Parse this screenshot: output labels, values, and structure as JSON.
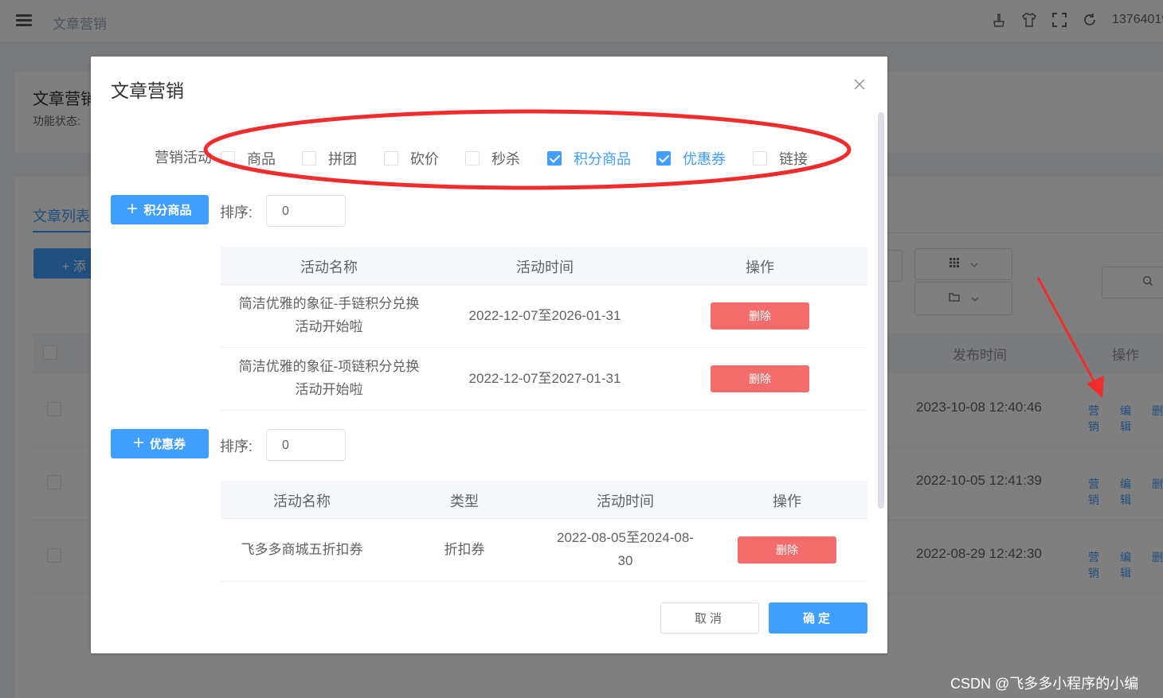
{
  "app": {
    "breadcrumb": "文章营销",
    "user": "13764019"
  },
  "page": {
    "card_title": "文章营销",
    "card_sub": "功能状态:",
    "tab_label": "文章列表",
    "add_button": "+ 添",
    "table_headers": {
      "publish_time": "发布时间",
      "ops": "操作"
    },
    "rows": [
      {
        "time": "2023-10-08 12:40:46",
        "op_marketing": "营销",
        "op_edit": "编辑",
        "op_more": "删"
      },
      {
        "time": "2022-10-05 12:41:39",
        "op_marketing": "营销",
        "op_edit": "编辑",
        "op_more": "删"
      },
      {
        "time": "2022-08-29 12:42:30",
        "op_marketing": "营销",
        "op_edit": "编辑",
        "op_more": "删"
      }
    ]
  },
  "dialog": {
    "title": "文章营销",
    "activity_label": "营销活动",
    "checkboxes": [
      {
        "label": "商品",
        "checked": false
      },
      {
        "label": "拼团",
        "checked": false
      },
      {
        "label": "砍价",
        "checked": false
      },
      {
        "label": "秒杀",
        "checked": false
      },
      {
        "label": "积分商品",
        "checked": true
      },
      {
        "label": "优惠券",
        "checked": true
      },
      {
        "label": "链接",
        "checked": false
      }
    ],
    "points_section": {
      "button_label": "积分商品",
      "sort_label": "排序:",
      "sort_value": "0",
      "headers": [
        "活动名称",
        "活动时间",
        "操作"
      ],
      "rows": [
        {
          "name_line1": "简洁优雅的象征-手链积分兑换",
          "name_line2": "活动开始啦",
          "time": "2022-12-07至2026-01-31",
          "action": "删除"
        },
        {
          "name_line1": "简洁优雅的象征-项链积分兑换",
          "name_line2": "活动开始啦",
          "time": "2022-12-07至2027-01-31",
          "action": "删除"
        }
      ]
    },
    "coupon_section": {
      "button_label": "优惠券",
      "sort_label": "排序:",
      "sort_value": "0",
      "headers": [
        "活动名称",
        "类型",
        "活动时间",
        "操作"
      ],
      "rows": [
        {
          "name": "飞多多商城五折扣券",
          "type": "折扣券",
          "time_line1": "2022-08-05至2024-08-",
          "time_line2": "30",
          "action": "删除"
        }
      ]
    },
    "cancel_label": "取消",
    "ok_label": "确定"
  },
  "watermark": "CSDN @飞多多小程序的小编",
  "colors": {
    "primary": "#409eff",
    "danger": "#f56c6c",
    "annotation_red": "#f02c2c"
  }
}
